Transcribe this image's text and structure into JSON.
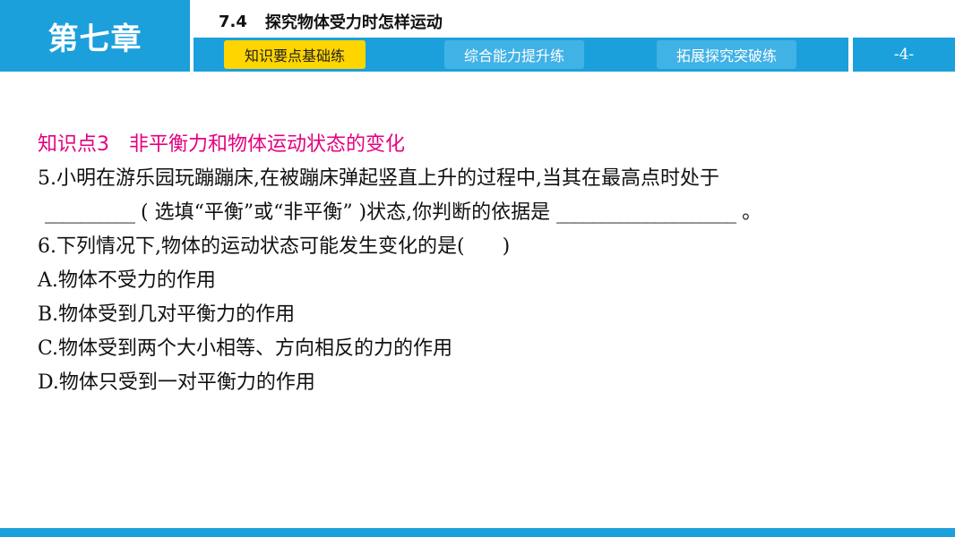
{
  "header": {
    "chapter": "第七章",
    "section_number": "7.4",
    "section_title": "探究物体受力时怎样运动",
    "tabs": [
      {
        "label": "知识要点基础练",
        "active": true
      },
      {
        "label": "综合能力提升练",
        "active": false
      },
      {
        "label": "拓展探究突破练",
        "active": false
      }
    ],
    "page_number": "-4-"
  },
  "content": {
    "knowledge_point_label": "知识点3",
    "knowledge_point_title": "非平衡力和物体运动状态的变化",
    "q5_line1": "5.小明在游乐园玩蹦蹦床,在被蹦床弹起竖直上升的过程中,当其在最高点时处于",
    "q5_blank1": "__________",
    "q5_mid": "( 选填“平衡”或“非平衡” )状态,你判断的依据是",
    "q5_blank2": "____________________",
    "q5_end": "。",
    "q6_stem": "6.下列情况下,物体的运动状态可能发生变化的是(",
    "q6_close": ")",
    "options": [
      "A.物体不受力的作用",
      "B.物体受到几对平衡力的作用",
      "C.物体受到两个大小相等、方向相反的力的作用",
      "D.物体只受到一对平衡力的作用"
    ]
  },
  "colors": {
    "primary_blue": "#1ca0dc",
    "tab_blue": "#41b2e6",
    "active_tab_yellow": "#ffd500",
    "knowledge_point_magenta": "#e4007f"
  }
}
